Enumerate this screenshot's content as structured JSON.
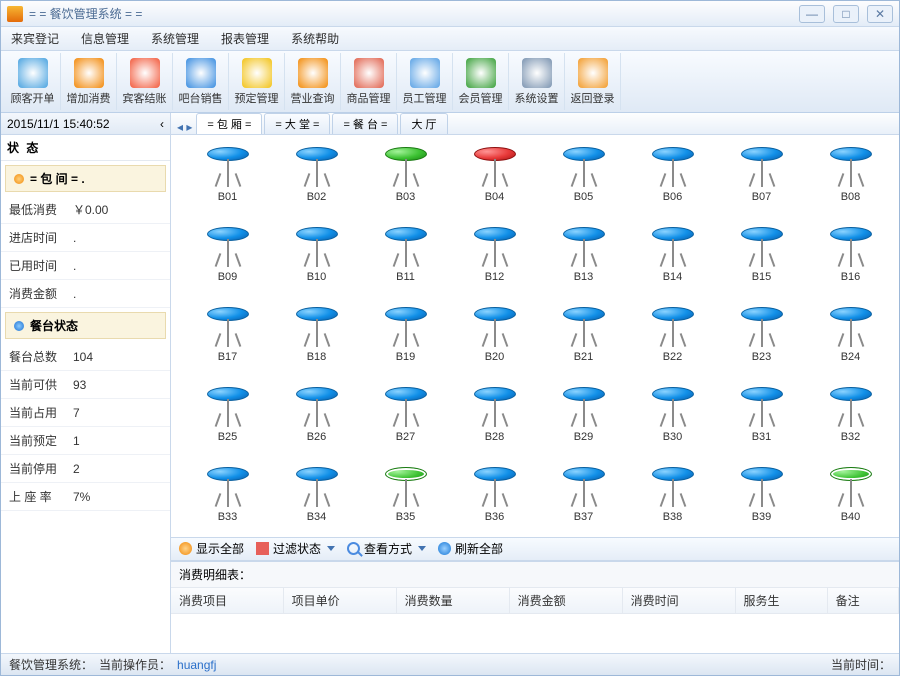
{
  "window": {
    "title": "= = 餐饮管理系统 = =",
    "min": "—",
    "max": "□",
    "close": "✕"
  },
  "menu": {
    "items": [
      "来宾登记",
      "信息管理",
      "系统管理",
      "报表管理",
      "系统帮助"
    ]
  },
  "toolbar": {
    "items": [
      {
        "label": "顾客开单",
        "color": "#4aa3e0"
      },
      {
        "label": "增加消费",
        "color": "#f2890a"
      },
      {
        "label": "宾客结账",
        "color": "#f25a3c"
      },
      {
        "label": "吧台销售",
        "color": "#3a8de0"
      },
      {
        "label": "预定管理",
        "color": "#f2c216"
      },
      {
        "label": "营业查询",
        "color": "#f28b0a"
      },
      {
        "label": "商品管理",
        "color": "#e0614c"
      },
      {
        "label": "员工管理",
        "color": "#5aa2e5"
      },
      {
        "label": "会员管理",
        "color": "#3aa03a"
      },
      {
        "label": "系统设置",
        "color": "#7a93b0"
      },
      {
        "label": "返回登录",
        "color": "#f29b2a"
      }
    ]
  },
  "datetime": "2015/11/1 15:40:52",
  "side": {
    "title": "状  态",
    "room_header": "= 包 间 = .",
    "room_rows": [
      {
        "k": "最低消费",
        "v": "￥0.00"
      },
      {
        "k": "进店时间",
        "v": "."
      },
      {
        "k": "已用时间",
        "v": "."
      },
      {
        "k": "消费金额",
        "v": "."
      }
    ],
    "status_header": "餐台状态",
    "status_rows": [
      {
        "k": "餐台总数",
        "v": "104"
      },
      {
        "k": "当前可供",
        "v": "93"
      },
      {
        "k": "当前占用",
        "v": "7"
      },
      {
        "k": "当前预定",
        "v": "1"
      },
      {
        "k": "当前停用",
        "v": "2"
      },
      {
        "k": "上 座 率",
        "v": "7%"
      }
    ]
  },
  "tabs": {
    "items": [
      "= 包 厢 =",
      "= 大 堂 =",
      "= 餐 台 =",
      "大 厅"
    ],
    "active": 0
  },
  "tables": [
    {
      "id": "B01",
      "state": "blue"
    },
    {
      "id": "B02",
      "state": "blue"
    },
    {
      "id": "B03",
      "state": "green"
    },
    {
      "id": "B04",
      "state": "red"
    },
    {
      "id": "B05",
      "state": "blue"
    },
    {
      "id": "B06",
      "state": "blue"
    },
    {
      "id": "B07",
      "state": "blue"
    },
    {
      "id": "B08",
      "state": "blue"
    },
    {
      "id": "B09",
      "state": "blue"
    },
    {
      "id": "B10",
      "state": "blue"
    },
    {
      "id": "B11",
      "state": "blue"
    },
    {
      "id": "B12",
      "state": "blue"
    },
    {
      "id": "B13",
      "state": "blue"
    },
    {
      "id": "B14",
      "state": "blue"
    },
    {
      "id": "B15",
      "state": "blue"
    },
    {
      "id": "B16",
      "state": "blue"
    },
    {
      "id": "B17",
      "state": "blue"
    },
    {
      "id": "B18",
      "state": "blue"
    },
    {
      "id": "B19",
      "state": "blue"
    },
    {
      "id": "B20",
      "state": "blue"
    },
    {
      "id": "B21",
      "state": "blue"
    },
    {
      "id": "B22",
      "state": "blue"
    },
    {
      "id": "B23",
      "state": "blue"
    },
    {
      "id": "B24",
      "state": "blue"
    },
    {
      "id": "B25",
      "state": "blue"
    },
    {
      "id": "B26",
      "state": "blue"
    },
    {
      "id": "B27",
      "state": "blue"
    },
    {
      "id": "B28",
      "state": "blue"
    },
    {
      "id": "B29",
      "state": "blue"
    },
    {
      "id": "B30",
      "state": "blue"
    },
    {
      "id": "B31",
      "state": "blue"
    },
    {
      "id": "B32",
      "state": "blue"
    },
    {
      "id": "B33",
      "state": "blue"
    },
    {
      "id": "B34",
      "state": "blue"
    },
    {
      "id": "B35",
      "state": "green",
      "label": true
    },
    {
      "id": "B36",
      "state": "blue"
    },
    {
      "id": "B37",
      "state": "blue"
    },
    {
      "id": "B38",
      "state": "blue"
    },
    {
      "id": "B39",
      "state": "blue"
    },
    {
      "id": "B40",
      "state": "green",
      "label": true
    }
  ],
  "filter": {
    "show_all": "显示全部",
    "filter_state": "过滤状态",
    "view_mode": "查看方式",
    "refresh_all": "刷新全部"
  },
  "details": {
    "title": "消费明细表：",
    "columns": [
      "消费项目",
      "项目单价",
      "消费数量",
      "消费金额",
      "消费时间",
      "服务生",
      "备注"
    ]
  },
  "status": {
    "system": "餐饮管理系统：",
    "operator_label": "当前操作员：",
    "operator": "huangfj",
    "time_label": "当前时间："
  }
}
